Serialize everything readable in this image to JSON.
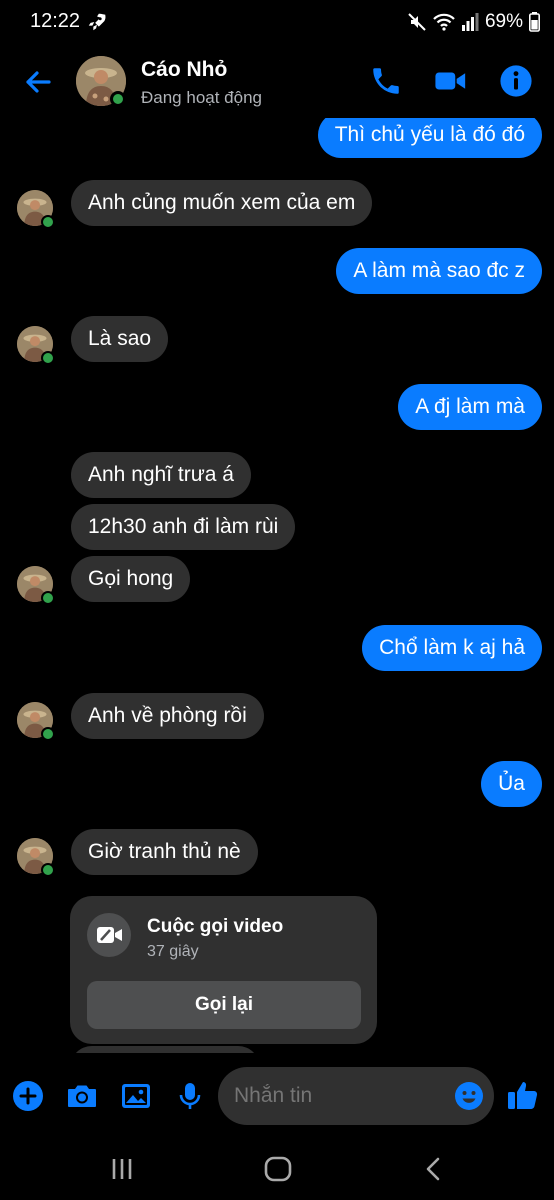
{
  "status_bar": {
    "time": "12:22",
    "battery": "69%"
  },
  "header": {
    "name": "Cáo Nhỏ",
    "status": "Đang hoạt động"
  },
  "messages": [
    {
      "from": "me",
      "text": "Thì chủ yếu là đó đó"
    },
    {
      "from": "them",
      "text": "Anh củng muốn xem của em"
    },
    {
      "from": "me",
      "text": "A làm mà sao đc z"
    },
    {
      "from": "them",
      "text": "Là sao"
    },
    {
      "from": "me",
      "text": "A đj làm mà"
    },
    {
      "from": "them",
      "text": "Anh nghĩ trưa á"
    },
    {
      "from": "them",
      "text": "12h30 anh đi làm rùi"
    },
    {
      "from": "them",
      "text": "Gọi hong"
    },
    {
      "from": "me",
      "text": "Chổ làm k aj hả"
    },
    {
      "from": "them",
      "text": "Anh về phòng rồi"
    },
    {
      "from": "me",
      "text": "Ủa"
    },
    {
      "from": "them",
      "text": "Giờ tranh thủ nè"
    }
  ],
  "call_card": {
    "title": "Cuộc gọi video",
    "duration": "37 giây",
    "button": "Gọi lại"
  },
  "composer": {
    "placeholder": "Nhắn tin"
  },
  "colors": {
    "accent": "#0a7cff",
    "incoming_bubble": "#303030",
    "online": "#31a24c",
    "background": "#000000"
  },
  "icons": {
    "header": [
      "back-arrow-icon",
      "phone-icon",
      "video-camera-icon",
      "info-icon"
    ],
    "composer": [
      "plus-icon",
      "camera-icon",
      "image-icon",
      "microphone-icon",
      "emoji-icon",
      "thumbs-up-icon"
    ],
    "nav": [
      "recent-apps-icon",
      "home-icon",
      "back-icon"
    ]
  }
}
